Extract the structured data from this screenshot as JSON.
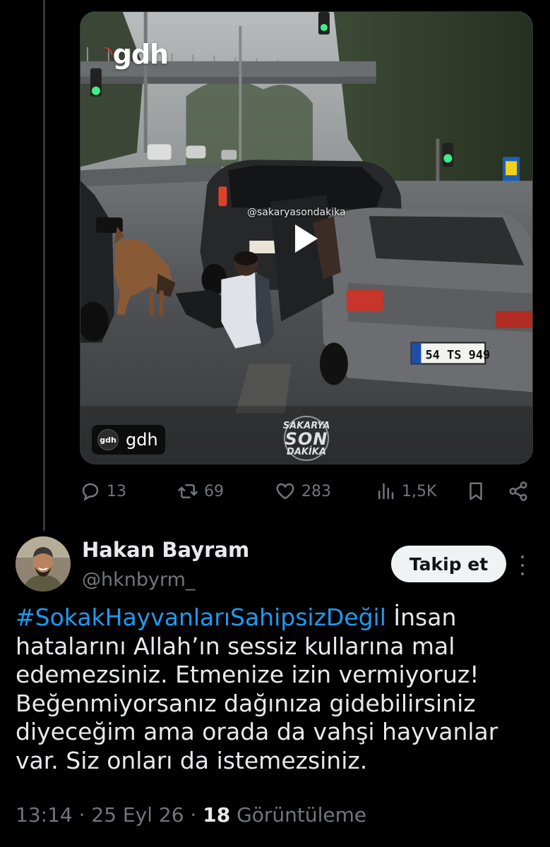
{
  "video": {
    "logo_text": "gdh",
    "watermark": "@sakaryasondakika",
    "source_label": "gdh",
    "source_logo_text": "gdh",
    "overlay_logo": [
      "SAKARYA",
      "SON",
      "DAKİKA"
    ],
    "plate_front": "54 TS 949"
  },
  "actions": {
    "replies": "13",
    "reposts": "69",
    "likes": "283",
    "views": "1,5K"
  },
  "reply_author": {
    "display_name": "Hakan Bayram",
    "handle": "@hknbyrm_",
    "follow_label": "Takip et"
  },
  "tweet": {
    "hashtag": "#SokakHayvanlarıSahipsizDeğil",
    "line1_rest": " İnsan",
    "lines": [
      "hatalarını Allah’ın sessiz kullarına mal",
      "edemezsiniz. Etmenize izin vermiyoruz!",
      "Beğenmiyorsanız dağınıza gidebilirsiniz",
      "diyeceğim ama orada da vahşi hayvanlar",
      "var. Siz onları da istemezsiniz."
    ]
  },
  "meta": {
    "time": "13:14",
    "sep1": " · ",
    "date": "25 Eyl 26",
    "sep2": " · ",
    "views_count": "18",
    "views_label": " Görüntüleme"
  }
}
